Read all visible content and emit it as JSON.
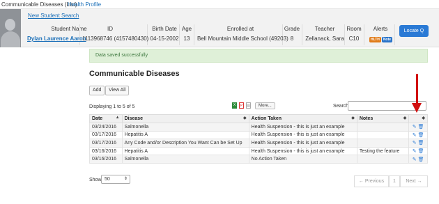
{
  "tabs": [
    "Communicable Diseases (List)",
    "Health Profile"
  ],
  "header": {
    "new_search_link": "New Student Search",
    "columns": [
      "Student Name",
      "ID",
      "Birth Date",
      "Age",
      "Enrolled at",
      "Grade",
      "Teacher",
      "Room",
      "Alerts"
    ],
    "student": {
      "name": "Dylan Laurence Aaron",
      "id": "1113968746 (4157480430)",
      "birth_date": "04-15-2002",
      "age": "13",
      "enrolled_at": "Bell Mountain Middle School (49203)",
      "grade": "8",
      "teacher": "Zellanack, Sara",
      "room": "C10"
    },
    "alerts": [
      "HLTH",
      "Note"
    ],
    "locate_button": "Locate Q"
  },
  "alert_message": "Data saved successfully",
  "section_title": "Communicable Diseases",
  "toolbar": {
    "add_label": "Add",
    "view_all_label": "View All",
    "more_label": "More...",
    "search_label": "Search",
    "search_value": ""
  },
  "displaying": "Displaying 1 to 5 of 5",
  "table": {
    "headers": [
      "Date",
      "Disease",
      "Action Taken",
      "Notes",
      ""
    ],
    "rows": [
      [
        "03/24/2016",
        "Salmonella",
        "Health Suspension - this is just an example",
        ""
      ],
      [
        "03/17/2016",
        "Hepatitis A",
        "Health Suspension - this is just an example",
        ""
      ],
      [
        "03/17/2016",
        "Any Code and/or Description You Want Can be Set Up",
        "Health Suspension - this is just an example",
        ""
      ],
      [
        "03/16/2016",
        "Hepatitis A",
        "Health Suspension - this is just an example",
        "Testing the feature"
      ],
      [
        "03/16/2016",
        "Salmonella",
        "No Action Taken",
        ""
      ]
    ]
  },
  "footer": {
    "show_label": "Show",
    "show_value": "50",
    "prev_label": "← Previous",
    "page_number": "1",
    "next_label": "Next →"
  },
  "icons": {
    "edit": "pencil-icon",
    "delete": "trash-icon",
    "export_excel": "excel-icon",
    "export_pdf": "pdf-icon",
    "export_print": "print-icon",
    "annotation_arrow": "red-arrow-icon"
  },
  "colors": {
    "accent": "#2a7ad5",
    "link": "#1a6fb8",
    "alert_bg": "#dff0d8",
    "alert_text": "#3c763d",
    "badge_hlth": "#e07b19",
    "badge_note": "#2a74c9",
    "annotation": "#d10f0f"
  }
}
